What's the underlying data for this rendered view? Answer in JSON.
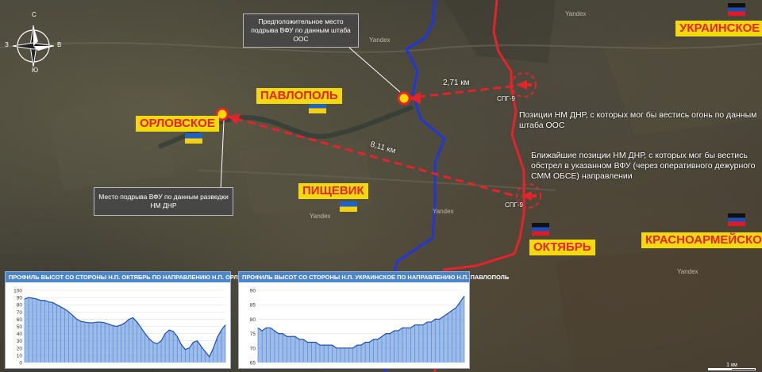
{
  "compass": {
    "n": "С",
    "s": "Ю",
    "w": "З",
    "e": "В"
  },
  "towns": {
    "ukrainskoe": "УКРАИНСКОЕ",
    "pavlopol": "ПАВЛОПОЛЬ",
    "orlovskoe": "ОРЛОВСКОЕ",
    "pishchevik": "ПИЩЕВИК",
    "oktyabr": "ОКТЯБРЬ",
    "krasnoarmeyskoe": "КРАСНОАРМЕЙСКОЕ"
  },
  "callouts": {
    "oos_explosion": "Предположительное место подрыва ВФУ по данным штаба ООС",
    "dnr_explosion": "Место подрыва ВФУ по данным разведки НМ ДНР"
  },
  "annotations": {
    "oos_positions": "Позиции НМ ДНР, с которых мог бы вестись огонь по данным штаба ООС",
    "nearest_positions": "Ближайшие позиции НМ ДНР, с которых мог бы вестись обстрел в указанном ВФУ (через оперативного дежурного СММ ОБСЕ) направлении"
  },
  "distances": {
    "d1": "2,71 км",
    "d2": "8,11 км"
  },
  "weapons": {
    "w1": "СПГ-9",
    "w2": "СПГ-9"
  },
  "watermark": "Yandex",
  "scale_label": "1 км",
  "colors": {
    "line_red": "#e4232b",
    "front_blue": "#2236d8",
    "label_bg": "#f5d90f",
    "marker_yellow": "#ffd800",
    "panel_header": "#4c86c9"
  },
  "chart_data": [
    {
      "type": "area",
      "title": "ПРОФИЛЬ ВЫСОТ СО СТОРОНЫ Н.П. ОКТЯБРЬ ПО НАПРАВЛЕНИЮ Н.П. ОРЛОВСКОЕ",
      "ylim": [
        0,
        100
      ],
      "yticks": [
        "0",
        "10",
        "20",
        "30",
        "40",
        "50",
        "60",
        "70",
        "80",
        "90",
        "100"
      ],
      "values": [
        88,
        90,
        89,
        88,
        86,
        86,
        84,
        83,
        80,
        77,
        74,
        70,
        65,
        60,
        57,
        56,
        55,
        55,
        56,
        56,
        55,
        53,
        51,
        50,
        52,
        55,
        60,
        62,
        56,
        48,
        40,
        33,
        28,
        26,
        30,
        40,
        45,
        43,
        36,
        25,
        18,
        20,
        28,
        30,
        22,
        15,
        8,
        20,
        35,
        45,
        52
      ]
    },
    {
      "type": "area",
      "title": "ПРОФИЛЬ ВЫСОТ СО СТОРОНЫ Н.П. УКРАИНСКОЕ ПО НАПРАВЛЕНИЮ Н.П. ПАВЛОПОЛЬ",
      "ylim": [
        65,
        90
      ],
      "yticks": [
        "65",
        "70",
        "75",
        "80",
        "85",
        "90"
      ],
      "values": [
        77,
        76,
        77,
        77,
        76,
        75,
        75,
        74,
        74,
        74,
        73,
        73,
        72,
        72,
        72,
        71,
        71,
        71,
        71,
        70,
        70,
        70,
        70,
        70,
        71,
        71,
        72,
        72,
        73,
        73,
        74,
        75,
        75,
        76,
        76,
        77,
        77,
        77,
        78,
        78,
        78,
        79,
        79,
        80,
        80,
        81,
        82,
        83,
        84,
        86,
        88
      ]
    }
  ]
}
